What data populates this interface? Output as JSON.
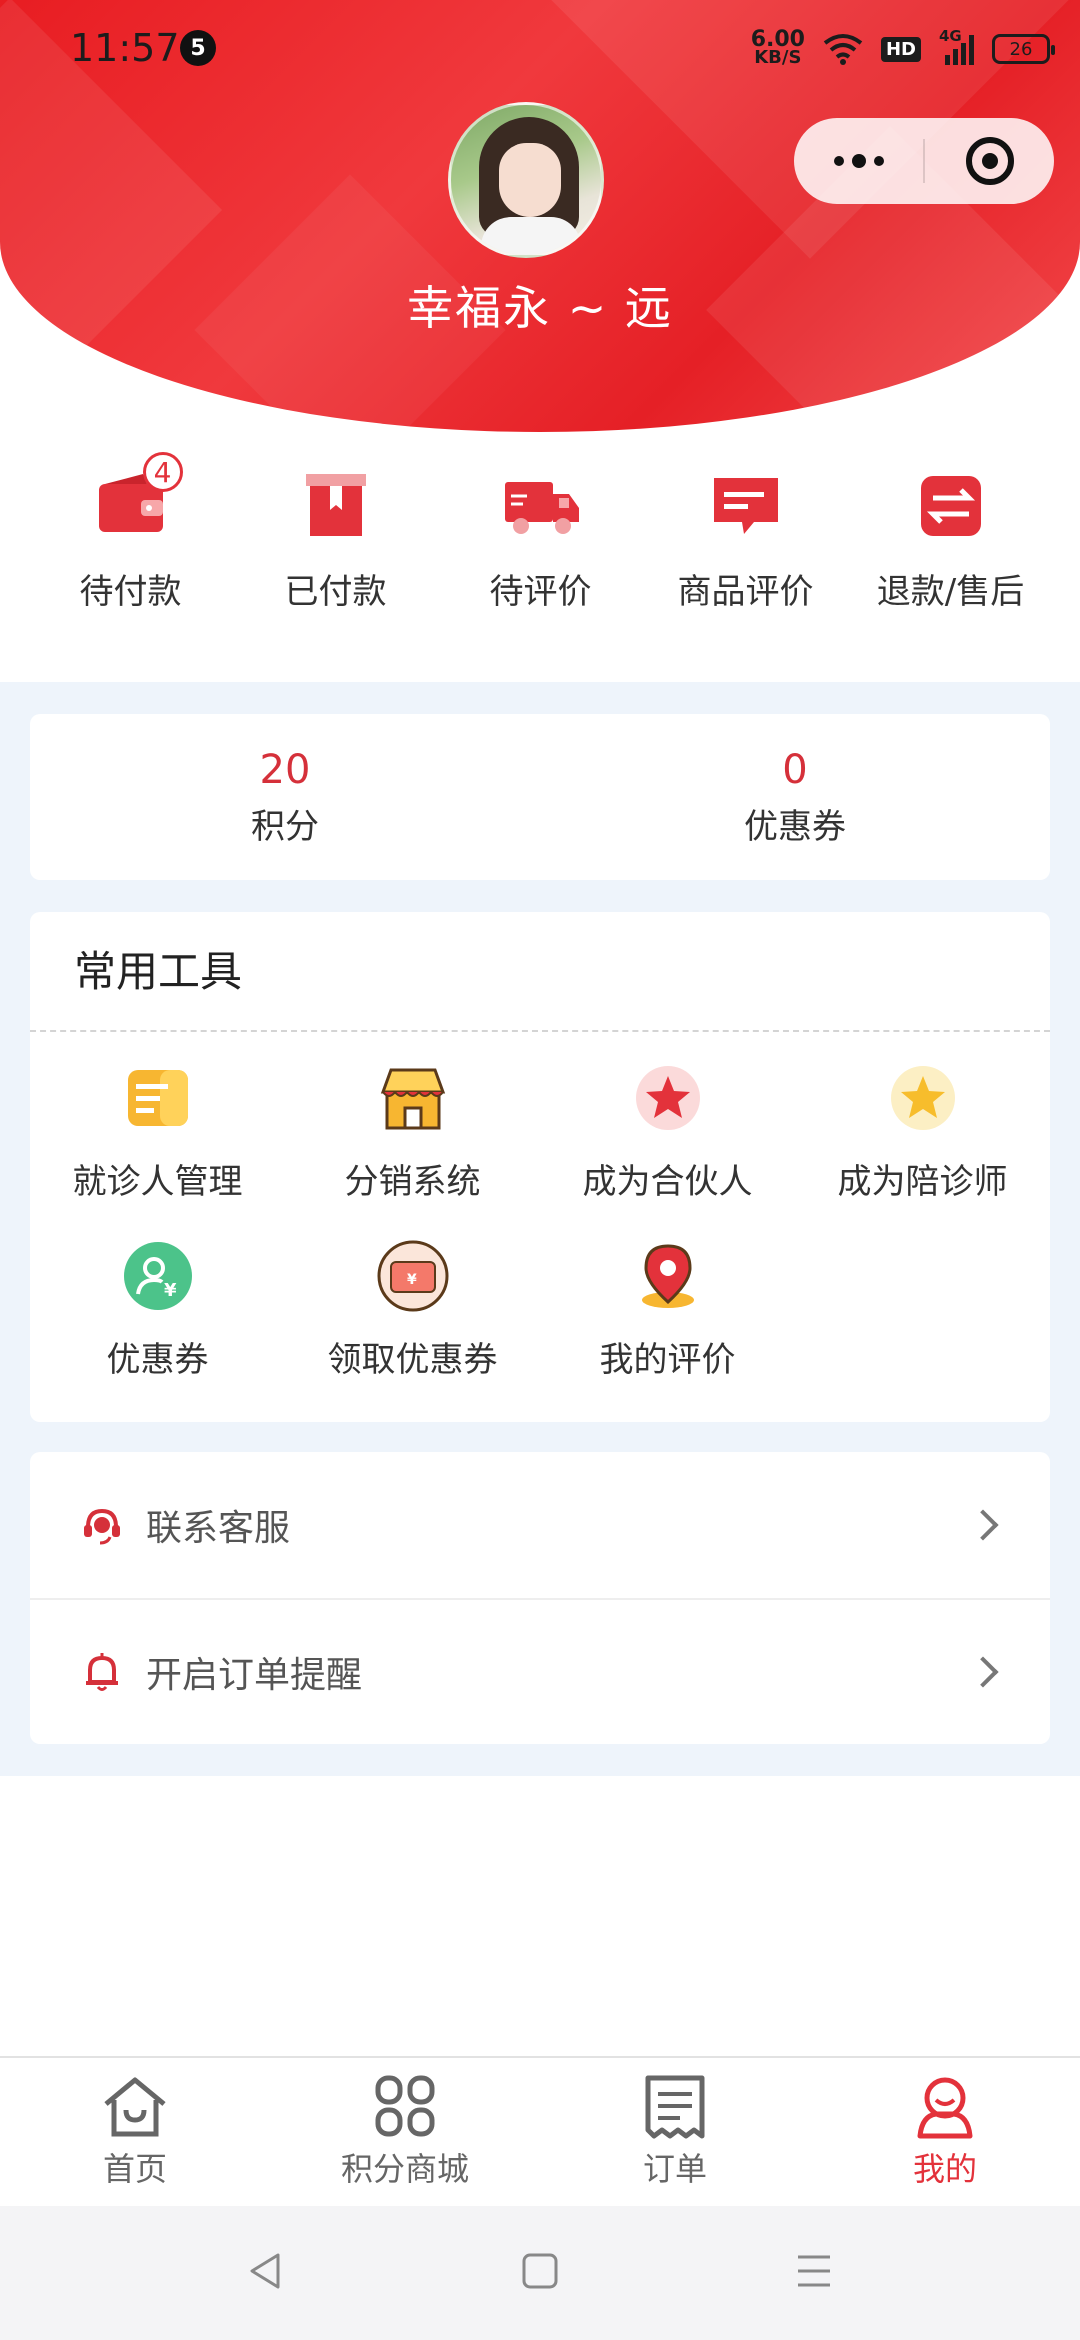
{
  "status_bar": {
    "time": "11:57",
    "notification_count": "5",
    "net_speed_value": "6.00",
    "net_speed_unit": "KB/S",
    "hd": "HD",
    "network": "4G",
    "battery": "26"
  },
  "profile": {
    "user_name": "幸福永 ~ 远"
  },
  "orders": [
    {
      "label": "待付款",
      "icon": "wallet-icon",
      "badge": "4"
    },
    {
      "label": "已付款",
      "icon": "box-icon"
    },
    {
      "label": "待评价",
      "icon": "truck-icon"
    },
    {
      "label": "商品评价",
      "icon": "comment-icon"
    },
    {
      "label": "退款/售后",
      "icon": "exchange-icon"
    }
  ],
  "points": {
    "points_value": "20",
    "points_label": "积分",
    "coupon_value": "0",
    "coupon_label": "优惠券"
  },
  "tools": {
    "title": "常用工具",
    "items": [
      {
        "label": "就诊人管理",
        "icon": "patient-card-icon"
      },
      {
        "label": "分销系统",
        "icon": "store-icon"
      },
      {
        "label": "成为合伙人",
        "icon": "star-red-icon"
      },
      {
        "label": "成为陪诊师",
        "icon": "star-gold-icon"
      },
      {
        "label": "优惠券",
        "icon": "user-yen-icon"
      },
      {
        "label": "领取优惠券",
        "icon": "coupon-ticket-icon"
      },
      {
        "label": "我的评价",
        "icon": "location-pin-icon"
      }
    ]
  },
  "list": [
    {
      "label": "联系客服",
      "icon": "headset-icon"
    },
    {
      "label": "开启订单提醒",
      "icon": "bell-icon"
    }
  ],
  "tabbar": [
    {
      "label": "首页",
      "icon": "home-icon"
    },
    {
      "label": "积分商城",
      "icon": "grid-icon"
    },
    {
      "label": "订单",
      "icon": "receipt-icon"
    },
    {
      "label": "我的",
      "icon": "profile-icon",
      "active": true
    }
  ],
  "colors": {
    "brand_red": "#e3323b",
    "header_red": "#e81d22",
    "page_bg": "#eef4fb"
  }
}
